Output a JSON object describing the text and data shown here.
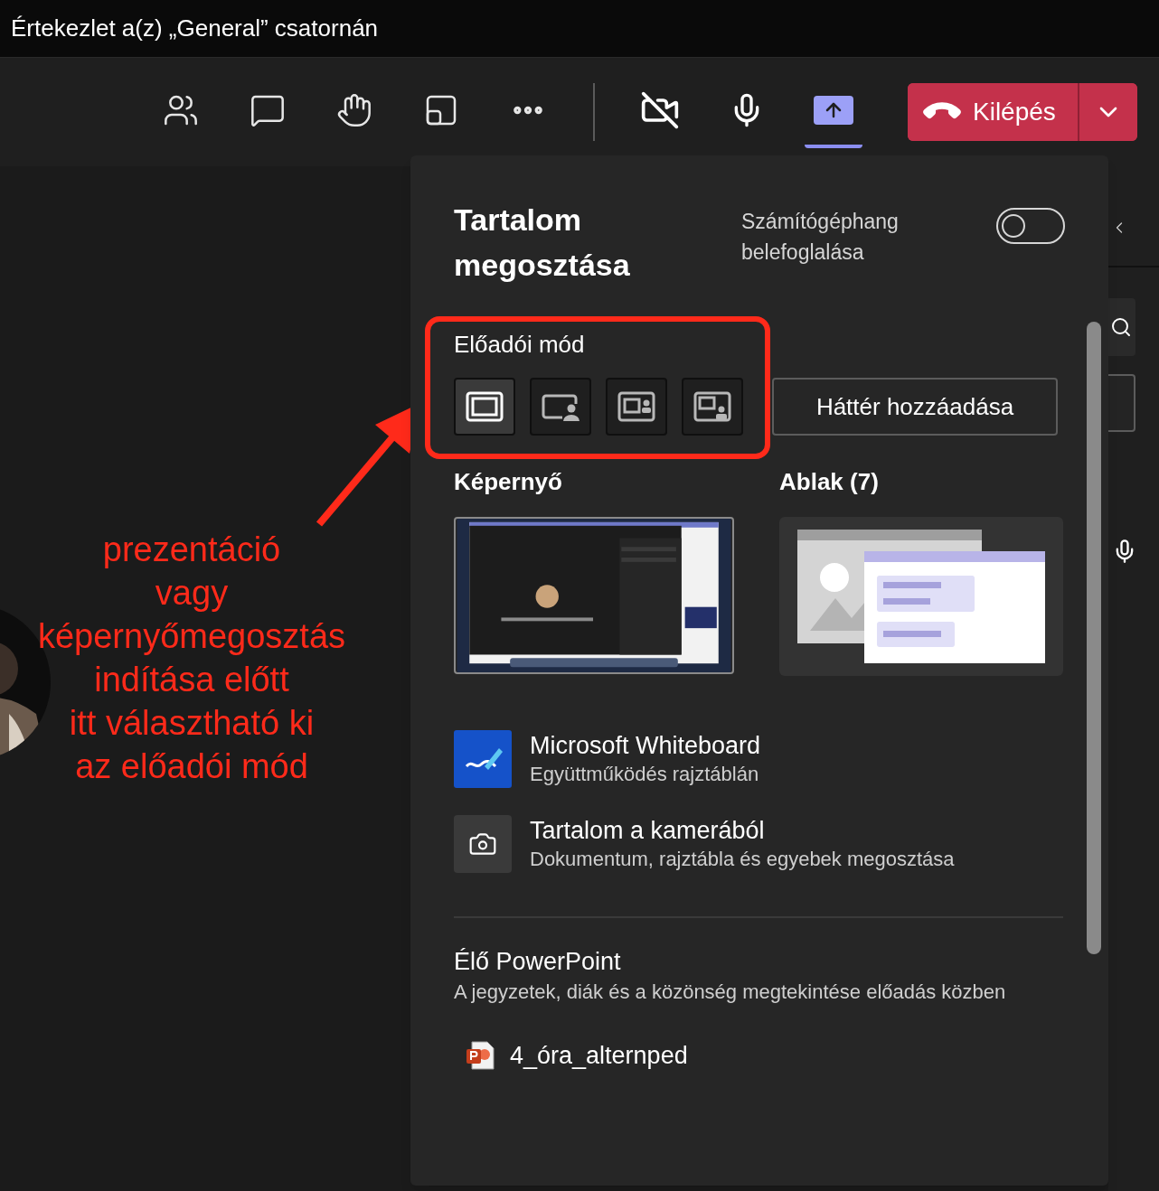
{
  "window": {
    "title": "Értekezlet a(z) „General” csatornán"
  },
  "toolbar": {
    "items": [
      {
        "kind": "people",
        "selected": false
      },
      {
        "kind": "chat",
        "selected": false
      },
      {
        "kind": "react",
        "selected": false
      },
      {
        "kind": "view",
        "selected": false
      },
      {
        "kind": "more",
        "selected": false
      },
      {
        "kind": "camera",
        "on": false,
        "selected": false
      },
      {
        "kind": "mic",
        "selected": false
      },
      {
        "kind": "share",
        "selected": true
      }
    ],
    "leave_button": {
      "label": "Kilépés"
    }
  },
  "share_panel": {
    "title": "Tartalom megosztása",
    "audio_toggle": {
      "label": "Számítógéphang belefoglalása",
      "on": false
    },
    "presenter_mode": {
      "label": "Előadói mód",
      "options": [
        {
          "kind": "content_only",
          "selected": true
        },
        {
          "kind": "standout",
          "selected": false
        },
        {
          "kind": "side_by_side",
          "selected": false
        },
        {
          "kind": "reporter",
          "selected": false
        }
      ]
    },
    "background_button": "Háttér hozzáadása",
    "sources": [
      {
        "kind": "screen",
        "label": "Képernyő"
      },
      {
        "kind": "window",
        "label": "Ablak (7)"
      }
    ],
    "apps": [
      {
        "kind": "whiteboard",
        "title": "Microsoft Whiteboard",
        "subtitle": "Együttműködés rajztáblán"
      },
      {
        "kind": "camera",
        "title": "Tartalom a kamerából",
        "subtitle": "Dokumentum, rajztábla és egyebek megosztása"
      }
    ],
    "powerpoint": {
      "title": "Élő PowerPoint",
      "description": "A jegyzetek, diák és a közönség megtekintése előadás közben",
      "files": [
        "4_óra_alternped"
      ]
    }
  },
  "annotation": {
    "lines": [
      "prezentáció",
      "vagy",
      "képernyőmegosztás",
      "indítása előtt",
      "itt választható ki",
      "az előadói mód"
    ],
    "color": "#ff2a1a"
  }
}
